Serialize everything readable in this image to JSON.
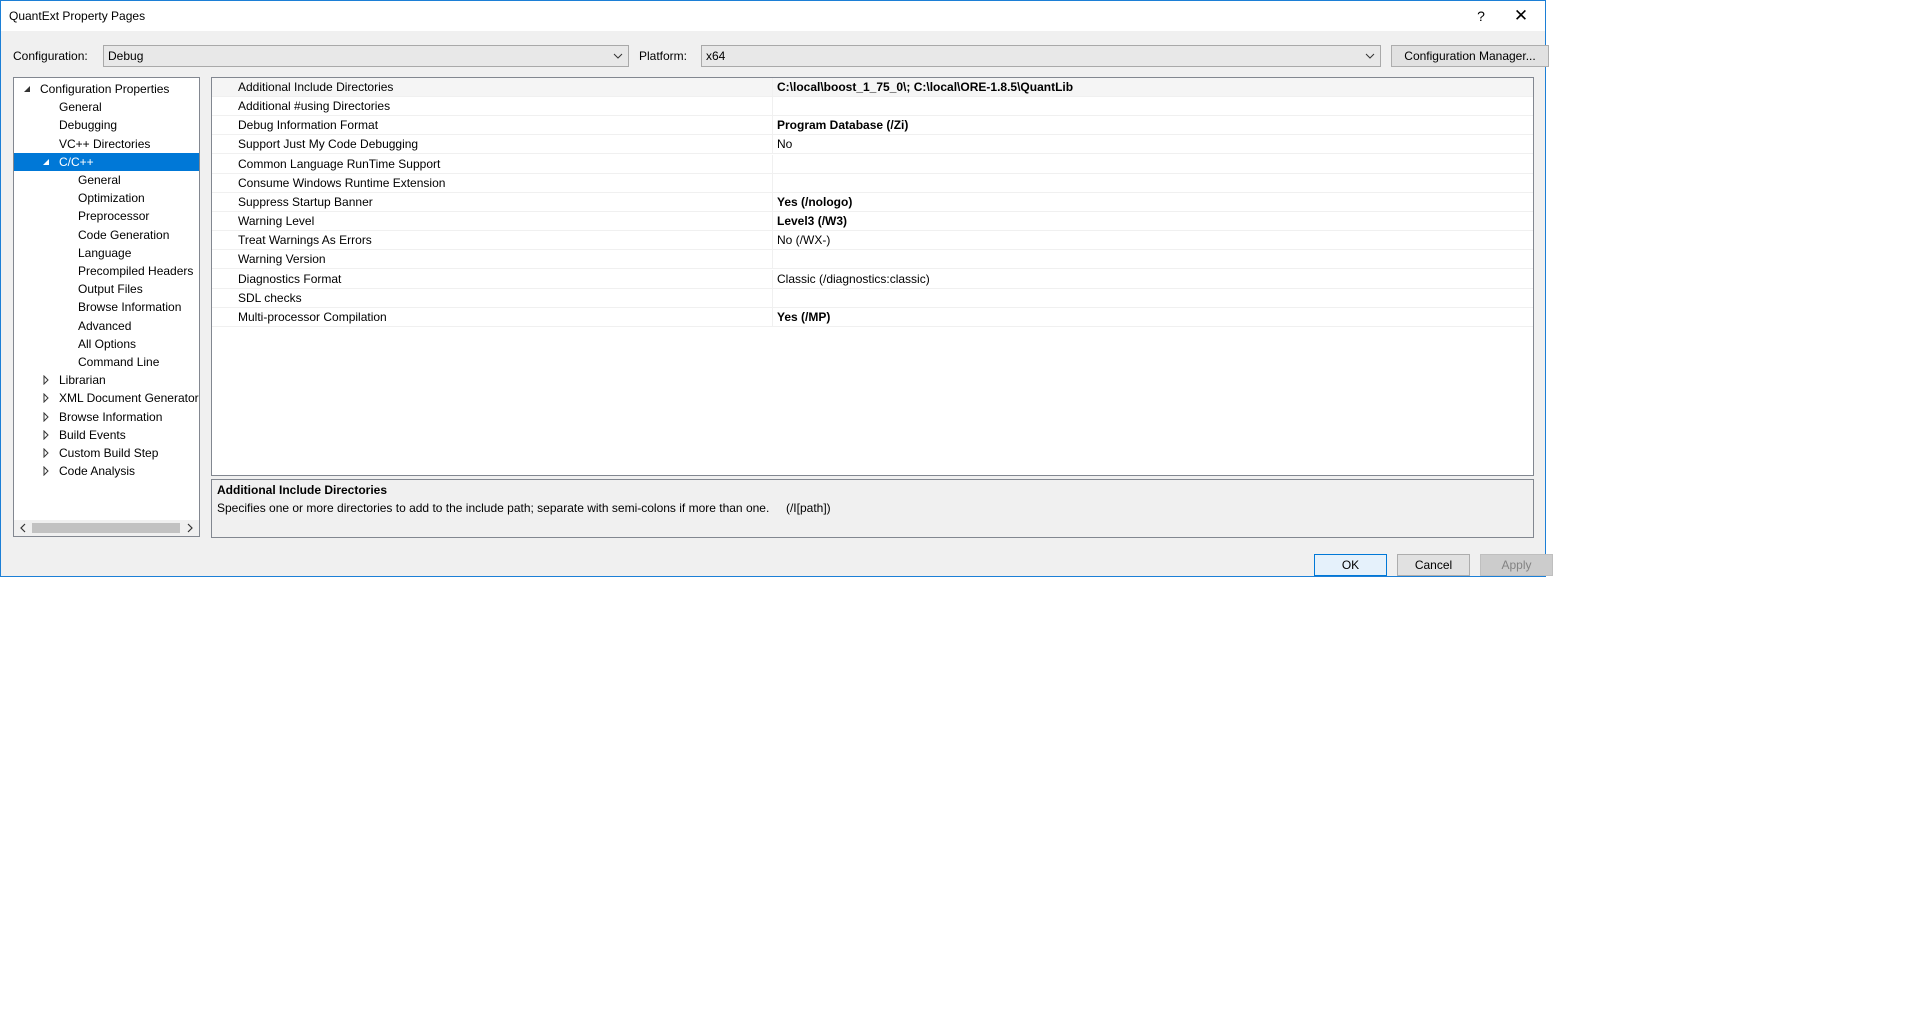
{
  "window": {
    "title": "QuantExt Property Pages",
    "help_glyph": "?",
    "close_glyph": "✕"
  },
  "toolbar": {
    "configuration_label": "Configuration:",
    "configuration_value": "Debug",
    "platform_label": "Platform:",
    "platform_value": "x64",
    "config_manager_label": "Configuration Manager..."
  },
  "tree": {
    "items": [
      {
        "label": "Configuration Properties",
        "level": 0,
        "expander": "expanded"
      },
      {
        "label": "General",
        "level": 1,
        "expander": "none"
      },
      {
        "label": "Debugging",
        "level": 1,
        "expander": "none"
      },
      {
        "label": "VC++ Directories",
        "level": 1,
        "expander": "none"
      },
      {
        "label": "C/C++",
        "level": 1,
        "expander": "expanded",
        "selected": true
      },
      {
        "label": "General",
        "level": 2,
        "expander": "none"
      },
      {
        "label": "Optimization",
        "level": 2,
        "expander": "none"
      },
      {
        "label": "Preprocessor",
        "level": 2,
        "expander": "none"
      },
      {
        "label": "Code Generation",
        "level": 2,
        "expander": "none"
      },
      {
        "label": "Language",
        "level": 2,
        "expander": "none"
      },
      {
        "label": "Precompiled Headers",
        "level": 2,
        "expander": "none"
      },
      {
        "label": "Output Files",
        "level": 2,
        "expander": "none"
      },
      {
        "label": "Browse Information",
        "level": 2,
        "expander": "none"
      },
      {
        "label": "Advanced",
        "level": 2,
        "expander": "none"
      },
      {
        "label": "All Options",
        "level": 2,
        "expander": "none"
      },
      {
        "label": "Command Line",
        "level": 2,
        "expander": "none"
      },
      {
        "label": "Librarian",
        "level": 1,
        "expander": "collapsed"
      },
      {
        "label": "XML Document Generator",
        "level": 1,
        "expander": "collapsed"
      },
      {
        "label": "Browse Information",
        "level": 1,
        "expander": "collapsed"
      },
      {
        "label": "Build Events",
        "level": 1,
        "expander": "collapsed"
      },
      {
        "label": "Custom Build Step",
        "level": 1,
        "expander": "collapsed"
      },
      {
        "label": "Code Analysis",
        "level": 1,
        "expander": "collapsed"
      }
    ]
  },
  "properties": [
    {
      "name": "Additional Include Directories",
      "value": "C:\\local\\boost_1_75_0\\; C:\\local\\ORE-1.8.5\\QuantLib",
      "bold": true
    },
    {
      "name": "Additional #using Directories",
      "value": "",
      "bold": false
    },
    {
      "name": "Debug Information Format",
      "value": "Program Database (/Zi)",
      "bold": true
    },
    {
      "name": "Support Just My Code Debugging",
      "value": "No",
      "bold": false
    },
    {
      "name": "Common Language RunTime Support",
      "value": "",
      "bold": false
    },
    {
      "name": "Consume Windows Runtime Extension",
      "value": "",
      "bold": false
    },
    {
      "name": "Suppress Startup Banner",
      "value": "Yes (/nologo)",
      "bold": true
    },
    {
      "name": "Warning Level",
      "value": "Level3 (/W3)",
      "bold": true
    },
    {
      "name": "Treat Warnings As Errors",
      "value": "No (/WX-)",
      "bold": false
    },
    {
      "name": "Warning Version",
      "value": "",
      "bold": false
    },
    {
      "name": "Diagnostics Format",
      "value": "Classic (/diagnostics:classic)",
      "bold": false
    },
    {
      "name": "SDL checks",
      "value": "",
      "bold": false
    },
    {
      "name": "Multi-processor Compilation",
      "value": "Yes (/MP)",
      "bold": true
    }
  ],
  "description": {
    "title": "Additional Include Directories",
    "text": "Specifies one or more directories to add to the include path; separate with semi-colons if more than one.     (/I[path])"
  },
  "buttons": {
    "ok": "OK",
    "cancel": "Cancel",
    "apply": "Apply"
  },
  "colors": {
    "accent": "#0078d7",
    "window_border": "#1c7fd6",
    "dialog_bg": "#f0f0f0"
  }
}
